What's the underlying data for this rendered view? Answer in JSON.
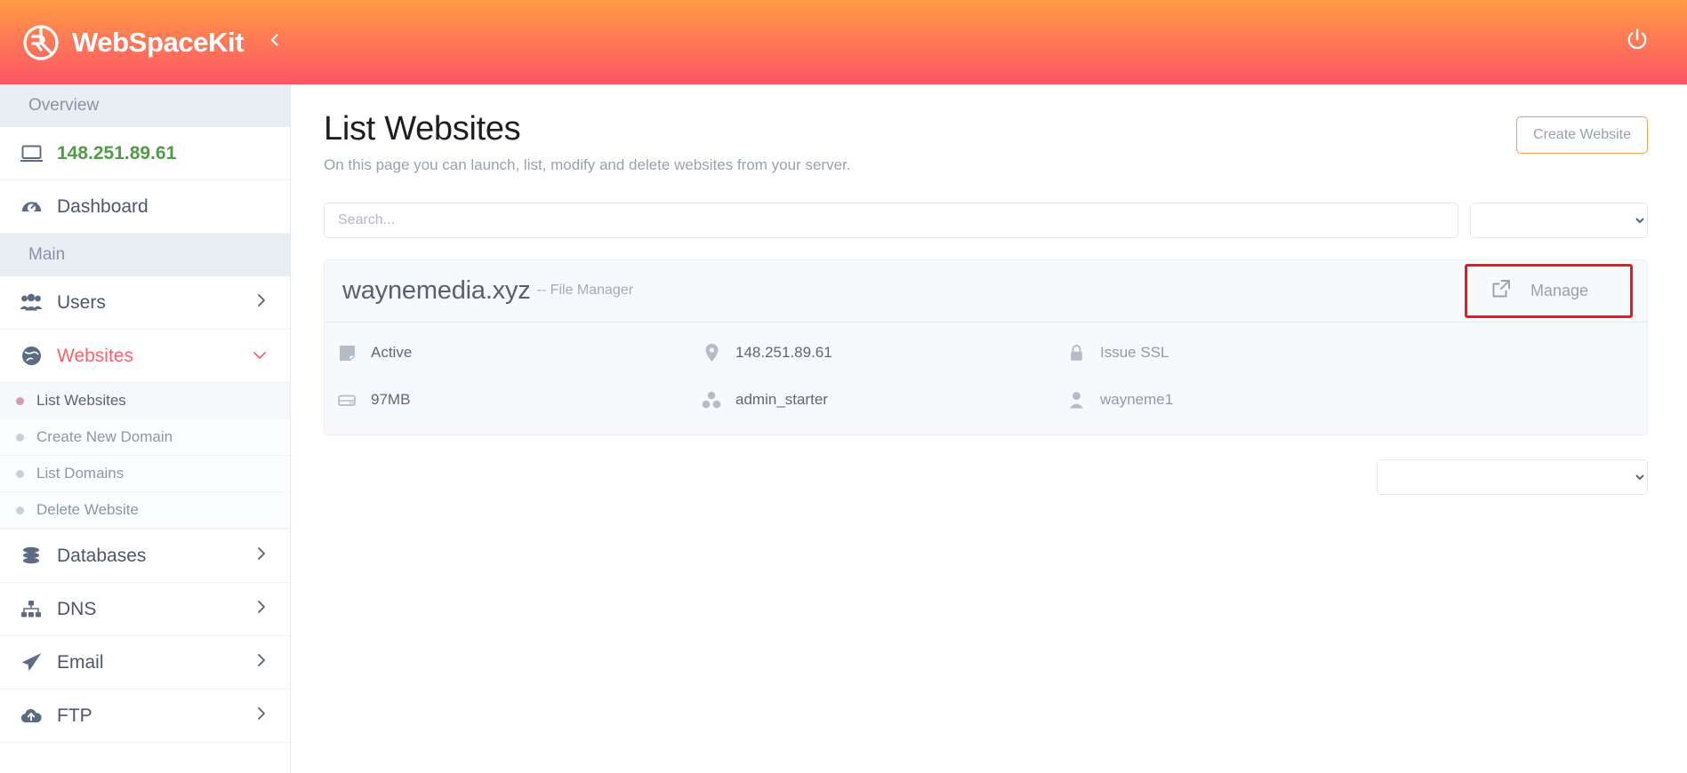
{
  "brand": {
    "name": "WebSpaceKit",
    "logo_icon": "webspacekit-logo-icon",
    "collapse_icon": "chevron-left-icon",
    "power_icon": "power-icon"
  },
  "sidebar": {
    "sections": [
      {
        "type": "section",
        "label": "Overview"
      },
      {
        "type": "item",
        "label": "148.251.89.61",
        "icon": "monitor-icon",
        "style": "ip",
        "chevron": ""
      },
      {
        "type": "item",
        "label": "Dashboard",
        "icon": "gauge-icon",
        "style": "normal",
        "chevron": ""
      },
      {
        "type": "section",
        "label": "Main"
      },
      {
        "type": "item",
        "label": "Users",
        "icon": "users-icon",
        "style": "normal",
        "chevron": "chevron-right-icon"
      },
      {
        "type": "item",
        "label": "Websites",
        "icon": "globe-icon",
        "style": "active",
        "chevron": "chevron-down-icon"
      },
      {
        "type": "submenu",
        "items": [
          {
            "label": "List Websites",
            "selected": true
          },
          {
            "label": "Create New Domain",
            "selected": false
          },
          {
            "label": "List Domains",
            "selected": false
          },
          {
            "label": "Delete Website",
            "selected": false
          }
        ]
      },
      {
        "type": "item",
        "label": "Databases",
        "icon": "database-icon",
        "style": "normal",
        "chevron": "chevron-right-icon"
      },
      {
        "type": "item",
        "label": "DNS",
        "icon": "sitemap-icon",
        "style": "normal",
        "chevron": "chevron-right-icon"
      },
      {
        "type": "item",
        "label": "Email",
        "icon": "paper-plane-icon",
        "style": "normal",
        "chevron": "chevron-right-icon"
      },
      {
        "type": "item",
        "label": "FTP",
        "icon": "cloud-upload-icon",
        "style": "normal",
        "chevron": "chevron-right-icon"
      }
    ]
  },
  "page": {
    "title": "List Websites",
    "subtitle": "On this page you can launch, list, modify and delete websites from your server.",
    "create_button": "Create Website"
  },
  "filters": {
    "search_placeholder": "Search...",
    "search_value": "",
    "type_select_value": "",
    "type_select_options": [
      ""
    ]
  },
  "website": {
    "domain": "waynemedia.xyz",
    "domain_suffix": "-- File Manager",
    "manage_label": "Manage",
    "manage_icon": "external-link-icon",
    "rows": [
      [
        {
          "icon": "note-icon",
          "text": "Active",
          "muted": false
        },
        {
          "icon": "map-pin-icon",
          "text": "148.251.89.61",
          "muted": false
        },
        {
          "icon": "lock-icon",
          "text": "Issue SSL",
          "muted": true
        }
      ],
      [
        {
          "icon": "hdd-icon",
          "text": "97MB",
          "muted": false
        },
        {
          "icon": "package-icon",
          "text": "admin_starter",
          "muted": false
        },
        {
          "icon": "user-icon",
          "text": "wayneme1",
          "muted": true
        }
      ]
    ]
  },
  "pagination": {
    "select_value": "",
    "select_options": [
      ""
    ]
  },
  "colors": {
    "header_gradient_start": "#FF9A42",
    "header_gradient_end": "#FD5567",
    "accent": "#FD5F6D",
    "ip_green": "#4F9C46",
    "highlight_box": "#F5161B",
    "create_border": "#F0A04A"
  }
}
